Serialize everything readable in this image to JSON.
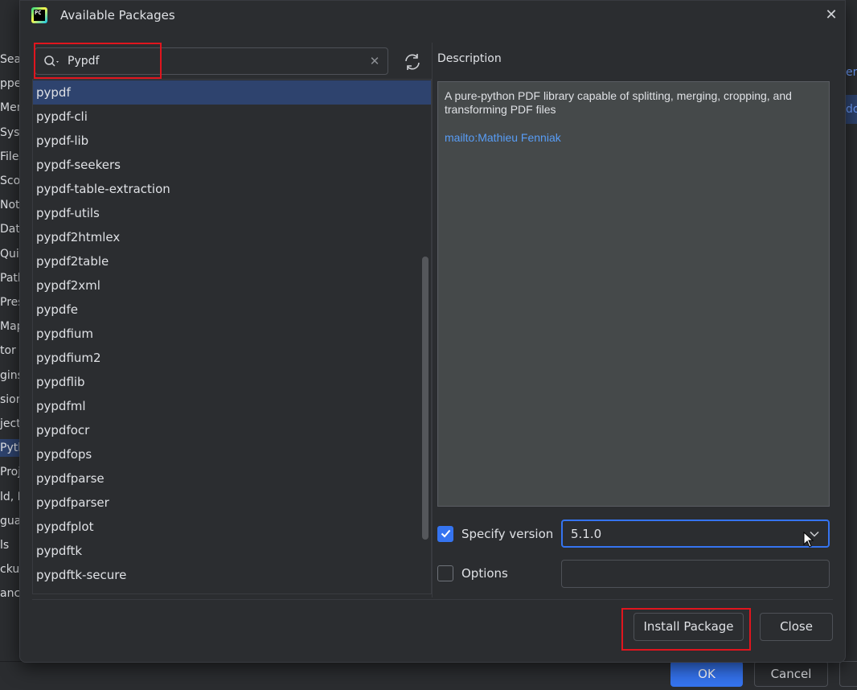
{
  "background_window": {
    "left_items": [
      "Searc",
      "ppea",
      "Menu",
      "Syste",
      "File C",
      "Scop",
      "Notif",
      "Data",
      "Quick",
      "Path",
      "Prese",
      "Map",
      "tor",
      "gins",
      "sion",
      "ject:",
      "Pytho",
      "Proje",
      "ld, Ex",
      "guag",
      "ls",
      "ckup",
      "ance"
    ],
    "left_selected_index": 16,
    "right_texts": [
      "en",
      "do"
    ],
    "ok_label": "OK",
    "cancel_label": "Cancel",
    "accent": "#3574f0"
  },
  "dialog": {
    "title": "Available Packages",
    "app_icon": "pycharm-logo",
    "app_icon_text": "PC",
    "close_icon": "close-icon"
  },
  "search": {
    "value": "Pypdf",
    "icon": "search-icon",
    "clear_icon": "clear-icon",
    "refresh_icon": "refresh-icon"
  },
  "packages": {
    "selected_index": 0,
    "items": [
      "pypdf",
      "pypdf-cli",
      "pypdf-lib",
      "pypdf-seekers",
      "pypdf-table-extraction",
      "pypdf-utils",
      "pypdf2htmlex",
      "pypdf2table",
      "pypdf2xml",
      "pypdfe",
      "pypdfium",
      "pypdfium2",
      "pypdflib",
      "pypdfml",
      "pypdfocr",
      "pypdfops",
      "pypdfparse",
      "pypdfparser",
      "pypdfplot",
      "pypdftk",
      "pypdftk-secure"
    ]
  },
  "description": {
    "label": "Description",
    "text": "A pure-python PDF library capable of splitting, merging, cropping, and transforming PDF files",
    "link": "mailto:Mathieu Fenniak",
    "link_color": "#589df6"
  },
  "version": {
    "checkbox_label": "Specify version",
    "checked": true,
    "value": "5.1.0"
  },
  "options": {
    "checkbox_label": "Options",
    "checked": false,
    "value": ""
  },
  "buttons": {
    "install_label": "Install Package",
    "close_label": "Close"
  },
  "highlight_color": "#e0151e"
}
